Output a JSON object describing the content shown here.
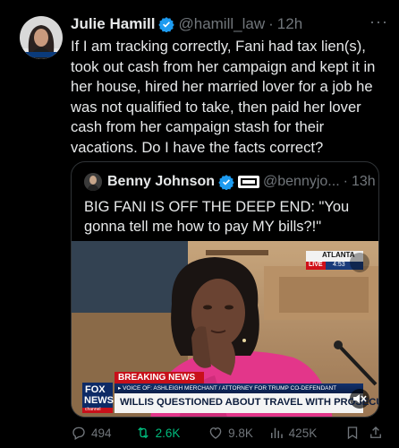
{
  "tweet": {
    "author_name": "Julie Hamill",
    "handle": "@hamill_law",
    "separator": "·",
    "time": "12h",
    "more": "···",
    "text": "If I am tracking correctly, Fani had tax lien(s), took out cash from her campaign and kept it in her house, hired her married lover for a job he was not qualified to take,  then paid her lover cash from her campaign stash for their vacations. Do I have the facts correct?"
  },
  "quote": {
    "author_name": "Benny Johnson",
    "handle": "@bennyjo...",
    "separator": "·",
    "time": "13h",
    "text": "BIG FANI IS OFF THE DEEP END: \"You gonna tell me how to pay MY bills?!\"",
    "video": {
      "location_tag": "ATLANTA",
      "live_tag": "LIVE",
      "clock": "4:53",
      "breaking_label": "BREAKING NEWS",
      "ticker": "▸ VOICE OF: ASHLEIGH MERCHANT / ATTORNEY FOR TRUMP CO-DEFENDANT",
      "headline": "WILLIS QUESTIONED ABOUT TRAVEL WITH PROSECUTOR",
      "network_top": "FOX",
      "network_mid": "NEWS",
      "network_bottom": "channel"
    }
  },
  "actions": {
    "replies": "494",
    "reposts": "2.6K",
    "likes": "9.8K",
    "views": "425K"
  },
  "colors": {
    "background": "#000000",
    "text": "#e7e9ea",
    "muted": "#71767b",
    "verified": "#1d9bf0",
    "repost_active": "#00ba7c",
    "border": "#2f3336"
  }
}
